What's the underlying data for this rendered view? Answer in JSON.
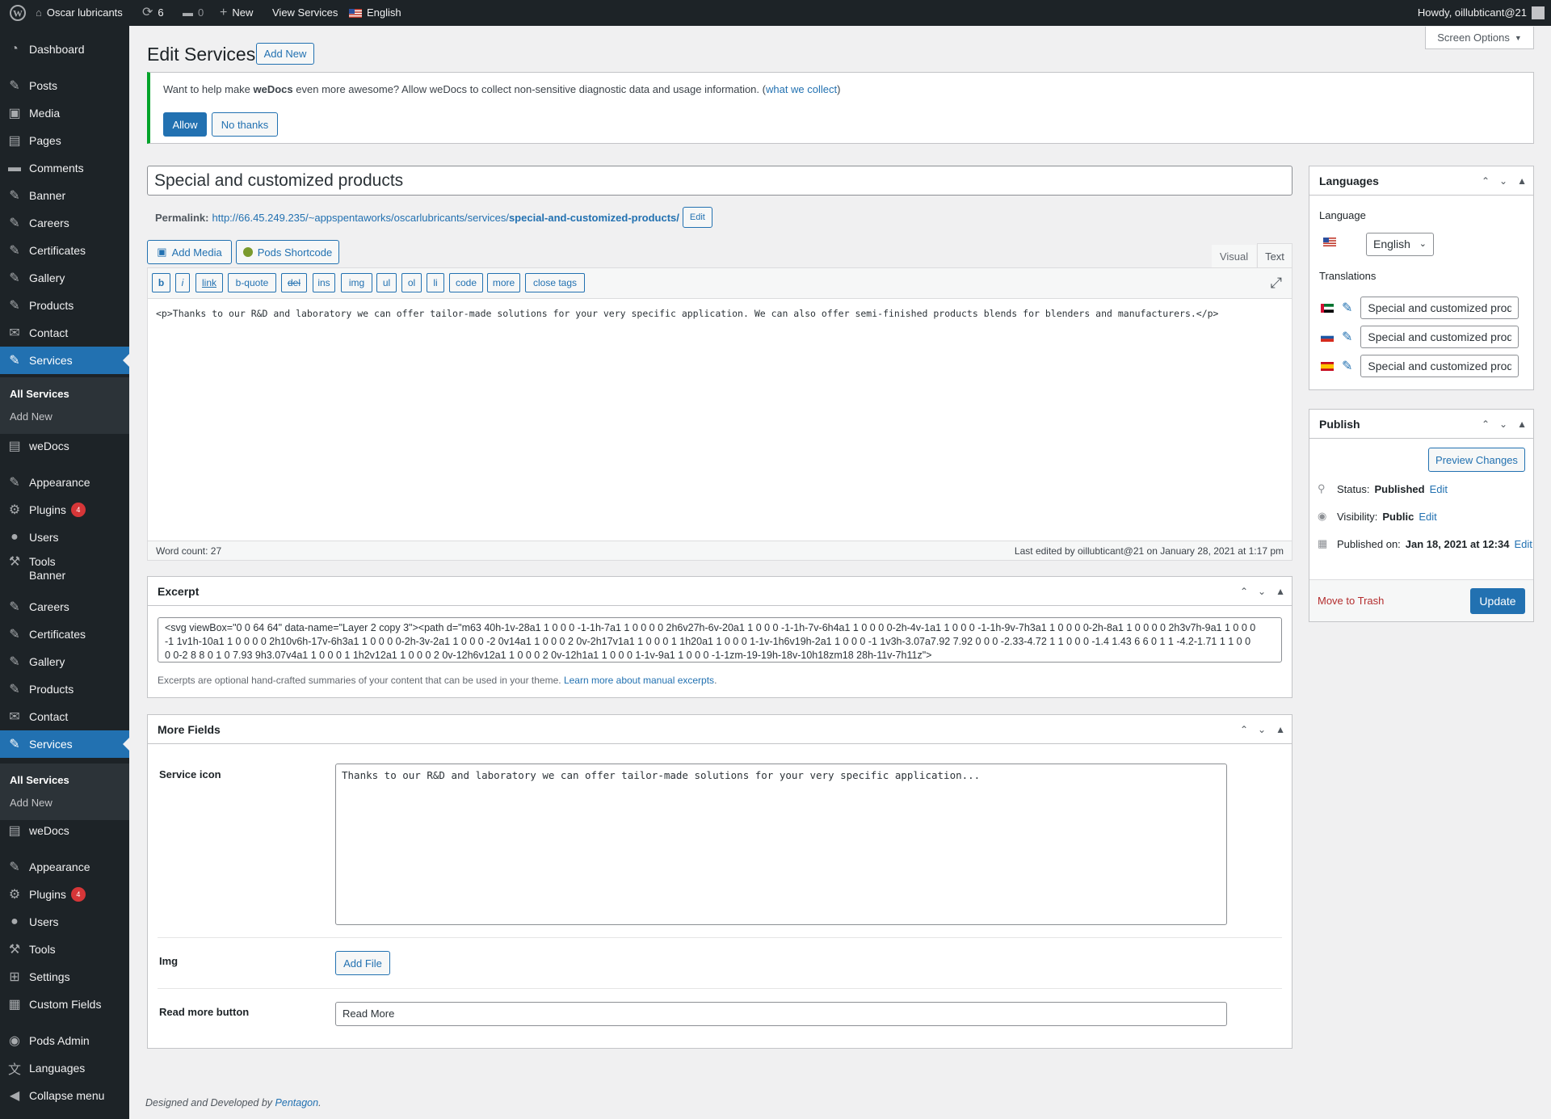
{
  "adminbar": {
    "site": "Oscar lubricants",
    "updates": "6",
    "comments": "0",
    "new": "New",
    "view": "View Services",
    "lang": "English",
    "howdy": "Howdy, oillubticant@21"
  },
  "menu": [
    {
      "label": "Dashboard",
      "icon": "dashboard-icon"
    },
    {
      "label": "Posts",
      "icon": "pin-icon"
    },
    {
      "label": "Media",
      "icon": "media-icon"
    },
    {
      "label": "Pages",
      "icon": "pages-icon"
    },
    {
      "label": "Comments",
      "icon": "comments-icon"
    },
    {
      "label": "Banner",
      "icon": "pin-icon"
    },
    {
      "label": "Careers",
      "icon": "pin-icon"
    },
    {
      "label": "Certificates",
      "icon": "pin-icon"
    },
    {
      "label": "Gallery",
      "icon": "pin-icon"
    },
    {
      "label": "Products",
      "icon": "pin-icon"
    },
    {
      "label": "Contact",
      "icon": "mail-icon"
    },
    {
      "label": "Services",
      "icon": "pin-icon"
    },
    {
      "label": "weDocs",
      "icon": "docs-icon"
    },
    {
      "label": "Appearance",
      "icon": "brush-icon"
    },
    {
      "label": "Plugins",
      "icon": "plugin-icon",
      "badge": "4"
    },
    {
      "label": "Users",
      "icon": "users-icon"
    },
    {
      "label": "Tools",
      "icon": "tools-icon"
    },
    {
      "label": "Banner",
      "icon": "pin-icon"
    },
    {
      "label": "Careers",
      "icon": "pin-icon"
    },
    {
      "label": "Certificates",
      "icon": "pin-icon"
    },
    {
      "label": "Gallery",
      "icon": "pin-icon"
    },
    {
      "label": "Products",
      "icon": "pin-icon"
    },
    {
      "label": "Contact",
      "icon": "mail-icon"
    },
    {
      "label": "Services",
      "icon": "pin-icon"
    },
    {
      "label": "weDocs",
      "icon": "docs-icon"
    },
    {
      "label": "Appearance",
      "icon": "brush-icon"
    },
    {
      "label": "Plugins",
      "icon": "plugin-icon",
      "badge": "4"
    },
    {
      "label": "Users",
      "icon": "users-icon"
    },
    {
      "label": "Tools",
      "icon": "tools-icon"
    },
    {
      "label": "Settings",
      "icon": "settings-icon"
    },
    {
      "label": "Custom Fields",
      "icon": "fields-icon"
    },
    {
      "label": "Pods Admin",
      "icon": "pods-icon"
    },
    {
      "label": "Languages",
      "icon": "languages-icon"
    },
    {
      "label": "Collapse menu",
      "icon": "collapse-icon"
    }
  ],
  "submenu": {
    "all": "All Services",
    "add": "Add New"
  },
  "page": {
    "title": "Edit Services",
    "add_new": "Add New",
    "screen_options": "Screen Options"
  },
  "notice": {
    "pre": "Want to help make ",
    "brand": "weDocs",
    "post": " even more awesome? Allow weDocs to collect non-sensitive diagnostic data and usage information. (",
    "link": "what we collect",
    "close": ")",
    "allow": "Allow",
    "no": "No thanks"
  },
  "post": {
    "title": "Special and customized products",
    "permalink_label": "Permalink:",
    "permalink_base": "http://66.45.249.235/~appspentaworks/oscarlubricants/services/",
    "permalink_slug": "special-and-customized-products/",
    "edit": "Edit"
  },
  "editor": {
    "add_media": "Add Media",
    "pods": "Pods Shortcode",
    "visual": "Visual",
    "text": "Text",
    "quicktags": [
      "b",
      "i",
      "link",
      "b-quote",
      "del",
      "ins",
      "img",
      "ul",
      "ol",
      "li",
      "code",
      "more",
      "close tags"
    ],
    "content": "<p>Thanks to our R&D and laboratory we can offer tailor-made solutions for your very specific application. We can also offer semi-finished products blends for blenders and manufacturers.</p>",
    "wordcount": "Word count: 27",
    "lastedit": "Last edited by oillubticant@21 on January 28, 2021 at 1:17 pm"
  },
  "excerpt": {
    "title": "Excerpt",
    "value": "<svg viewBox=\"0 0 64 64\" data-name=\"Layer 2 copy 3\"><path d=\"m63 40h-1v-28a1 1 0 0 0 -1-1h-7a1 1 0 0 0 0 2h6v27h-6v-20a1 1 0 0 0 -1-1h-7v-6h4a1 1 0 0 0 0-2h-4v-1a1 1 0 0 0 -1-1h-9v-7h3a1 1 0 0 0 0-2h-8a1 1 0 0 0 0 2h3v7h-9a1 1 0 0 0 -1 1v1h-10a1 1 0 0 0 0 2h10v6h-17v-6h3a1 1 0 0 0 0-2h-3v-2a1 1 0 0 0 -2 0v14a1 1 0 0 0 2 0v-2h17v1a1 1 0 0 0 1 1h20a1 1 0 0 0 1-1v-1h6v19h-2a1 1 0 0 0 -1 1v3h-3.07a7.92 7.92 0 0 0 -2.33-4.72 1 1 0 0 0 -1.4 1.43 6 6 0 1 1 -4.2-1.71 1 1 0 0 0 0-2 8 8 0 1 0 7.93 9h3.07v4a1 1 0 0 0 1 1h2v12a1 1 0 0 0 2 0v-12h6v12a1 1 0 0 0 2 0v-12h1a1 1 0 0 0 1-1v-9a1 1 0 0 0 -1-1zm-19-19h-18v-10h18zm18 28h-11v-7h11z\">",
    "help": "Excerpts are optional hand-crafted summaries of your content that can be used in your theme.",
    "learn": "Learn more about manual excerpts",
    "dot": "."
  },
  "fields": {
    "title": "More Fields",
    "service_icon": "Service icon",
    "service_icon_value": "Thanks to our R&D and laboratory we can offer tailor-made solutions for your very specific application...",
    "img": "Img",
    "add_file": "Add File",
    "read_more": "Read more button",
    "read_more_value": "Read More"
  },
  "languages": {
    "title": "Languages",
    "language": "Language",
    "selected": "English",
    "translations": "Translations",
    "items": [
      "Special and customized prod",
      "Special and customized prod",
      "Special and customized prod"
    ]
  },
  "publish": {
    "title": "Publish",
    "preview": "Preview Changes",
    "status_label": "Status:",
    "status": "Published",
    "visibility_label": "Visibility:",
    "visibility": "Public",
    "published_label": "Published on:",
    "published": "Jan 18, 2021 at 12:34",
    "edit": "Edit",
    "trash": "Move to Trash",
    "update": "Update"
  },
  "footer": {
    "text": "Designed and Developed by ",
    "link": "Pentagon",
    "dot": "."
  }
}
